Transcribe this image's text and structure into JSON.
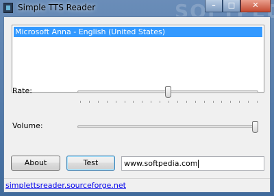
{
  "window": {
    "title": "Simple TTS Reader",
    "watermark": "SOFTPEDIA",
    "minimize_glyph": "–",
    "maximize_glyph": "□",
    "close_glyph": "✕"
  },
  "voices": {
    "items": [
      "Microsoft Anna - English (United States)"
    ],
    "selected": "Microsoft Anna - English (United States)"
  },
  "rate": {
    "label": "Rate:",
    "value_fraction": 0.5
  },
  "volume": {
    "label": "Volume:",
    "value_fraction": 1.0
  },
  "buttons": {
    "about": "About",
    "test": "Test"
  },
  "input": {
    "value": "www.softpedia.com"
  },
  "footer": {
    "link": "simplettsreader.sourceforge.net"
  },
  "colors": {
    "selection": "#3399ff",
    "link": "#0000ee"
  }
}
